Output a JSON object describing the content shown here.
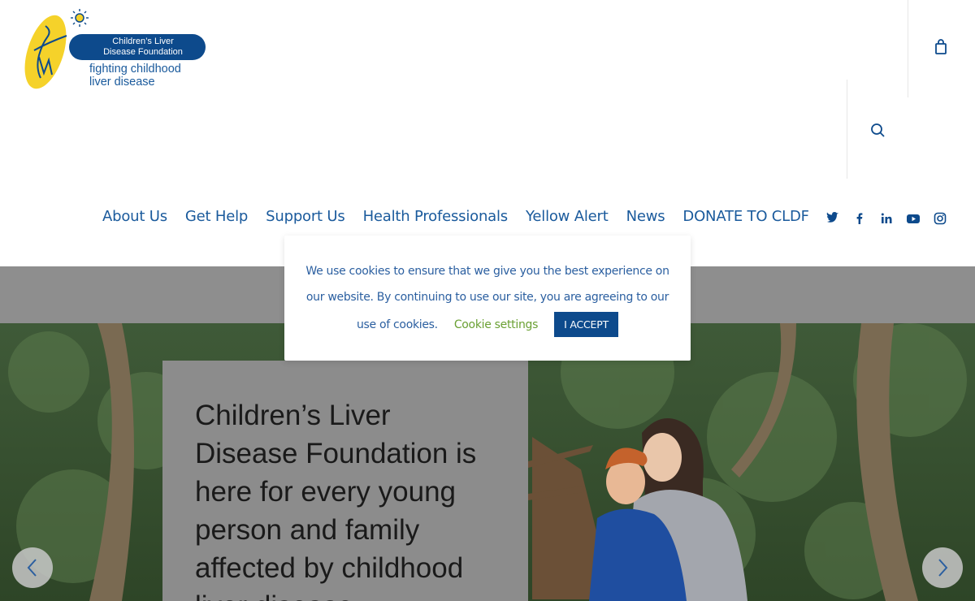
{
  "logo": {
    "name_line1": "Children’s Liver",
    "name_line2": "Disease Foundation",
    "tag_line1": "fighting childhood",
    "tag_line2": "liver disease"
  },
  "header_icons": {
    "cart": "shopping-bag-icon",
    "search": "search-icon"
  },
  "nav": {
    "items": [
      "About Us",
      "Get Help",
      "Support Us",
      "Health Professionals",
      "Yellow Alert",
      "News",
      "DONATE TO CLDF"
    ]
  },
  "social": [
    "twitter-icon",
    "facebook-icon",
    "linkedin-icon",
    "youtube-icon",
    "instagram-icon"
  ],
  "cookie": {
    "line1": "We use cookies to ensure that we give you the best experience on",
    "line2": "our website. By continuing to use our site, you are agreeing to our",
    "line3": "use of cookies.",
    "settings_label": "Cookie settings",
    "accept_label": "I ACCEPT"
  },
  "hero": {
    "heading_lines": [
      "Children’s Liver",
      "Disease Foundation is",
      "here for every young",
      "person and family",
      "affected by childhood",
      "liver disease"
    ]
  },
  "colors": {
    "brand_blue": "#0d4a8c",
    "nav_blue": "#1a5a9c",
    "logo_yellow": "#f5d22a",
    "cookie_green": "#6aa033"
  }
}
